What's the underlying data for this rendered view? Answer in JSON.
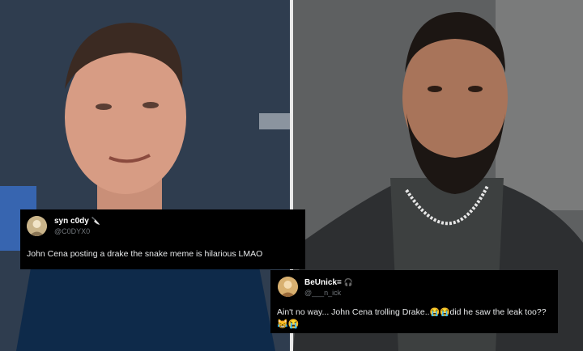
{
  "tweets": [
    {
      "display_name": "syn c0dy",
      "handle": "@C0DYX0",
      "text": "John Cena posting a drake the snake meme is hilarious LMAO",
      "name_icon": "knife-icon"
    },
    {
      "display_name": "BeUnick=",
      "handle": "@___n_ick",
      "name_icon": "headphones-icon",
      "text_part1": "Ain't no way... John Cena trolling Drake..",
      "emoji_1": "😭😭",
      "text_part2": "did he saw the leak too??",
      "emoji_2": "😹😭"
    }
  ],
  "colors": {
    "tweet_bg": "#000000",
    "handle": "#71767b",
    "text": "#e7e9ea",
    "divider": "#e9e9e9"
  }
}
